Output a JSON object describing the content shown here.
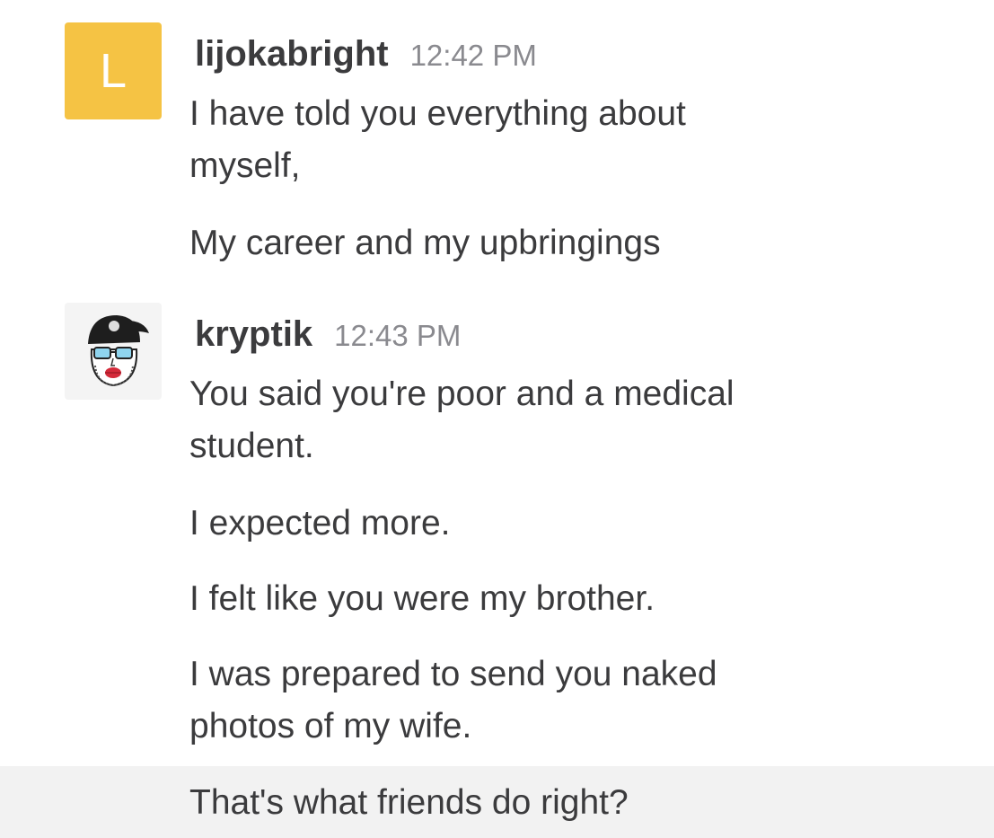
{
  "messages": [
    {
      "username": "lijokabright",
      "time": "12:42 PM",
      "avatar_letter": "L",
      "lines": [
        "I have told you everything about myself,",
        "My career and my upbringings"
      ]
    },
    {
      "username": "kryptik",
      "time": "12:43 PM",
      "lines": [
        "You said you're poor and a medical student.",
        "I expected more.",
        "I felt like you were my brother.",
        "I was prepared to send you naked photos of my wife.",
        "That's what friends do right?"
      ]
    }
  ],
  "colors": {
    "avatar_l_bg": "#f5c344",
    "text": "#3b3b3d",
    "timestamp": "#8a8a8f",
    "highlight": "#f2f2f2"
  }
}
